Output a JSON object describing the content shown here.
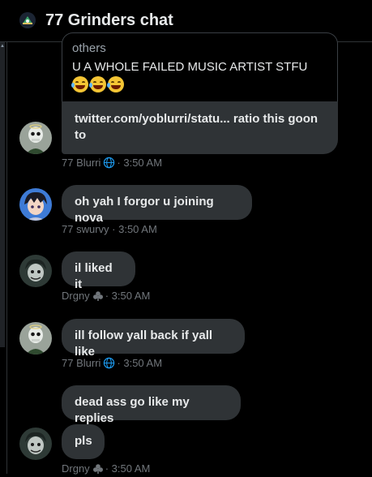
{
  "header": {
    "title": "77 Grinders chat"
  },
  "messages": {
    "m1": {
      "card_others": "others",
      "card_text": "U A WHOLE FAILED MUSIC ARTIST STFU",
      "link_text": "twitter.com/yoblurri/statu... ratio this goon to",
      "author": "77 Blurri",
      "time": "· 3:50 AM"
    },
    "m2": {
      "text": "oh yah I forgor u joining nova",
      "author": "77 swurvy",
      "time": "· 3:50 AM"
    },
    "m3": {
      "text": "il liked it",
      "author": "Drgny",
      "time": "· 3:50 AM"
    },
    "m4": {
      "text": "ill follow yall back if yall like",
      "author": "77 Blurri",
      "time": "· 3:50 AM"
    },
    "m5": {
      "text": "dead ass go like my replies"
    },
    "m6": {
      "text": "pls",
      "author": "Drgny",
      "time": "· 3:50 AM"
    }
  },
  "colors": {
    "bubble": "#2f3336",
    "text": "#e7e9ea",
    "meta": "#71767b",
    "globe": "#1d9bf0"
  }
}
